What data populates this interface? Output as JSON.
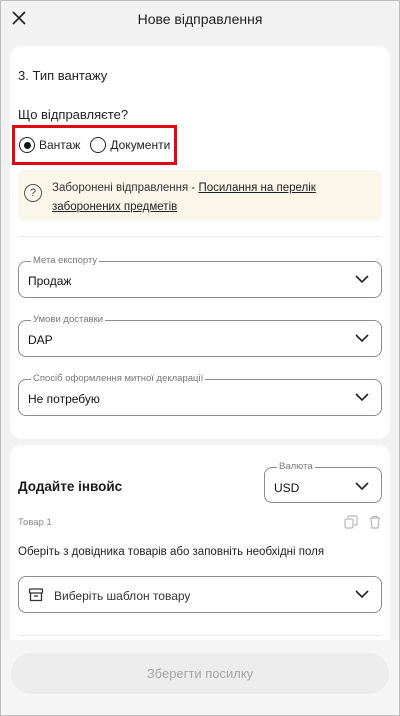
{
  "header": {
    "title": "Нове відправлення"
  },
  "cargo": {
    "section_title": "3. Тип вантажу",
    "question": "Що відправляєте?",
    "options": [
      {
        "label": "Вантаж",
        "selected": true
      },
      {
        "label": "Документи",
        "selected": false
      }
    ],
    "notice_text": "Заборонені відправлення - ",
    "notice_link": "Посилання на перелік заборонених предметів",
    "export_purpose": {
      "label": "Мета експорту",
      "value": "Продаж"
    },
    "delivery_terms": {
      "label": "Умови доставки",
      "value": "DAP"
    },
    "customs_method": {
      "label": "Спосіб оформлення митної декларації",
      "value": "Не потребую"
    }
  },
  "invoice": {
    "title": "Додайте інвойс",
    "currency": {
      "label": "Валюта",
      "value": "USD"
    },
    "item_label": "Товар 1",
    "hint": "Оберіть з довідника товарів або заповніть необхідні поля",
    "template_placeholder": "Виберіть шаблон товару"
  },
  "footer": {
    "save_label": "Зберегти посилку"
  },
  "colors": {
    "highlight": "#e30613",
    "notice_bg": "#fbf6ea",
    "disabled_text": "#a5a5a5"
  }
}
